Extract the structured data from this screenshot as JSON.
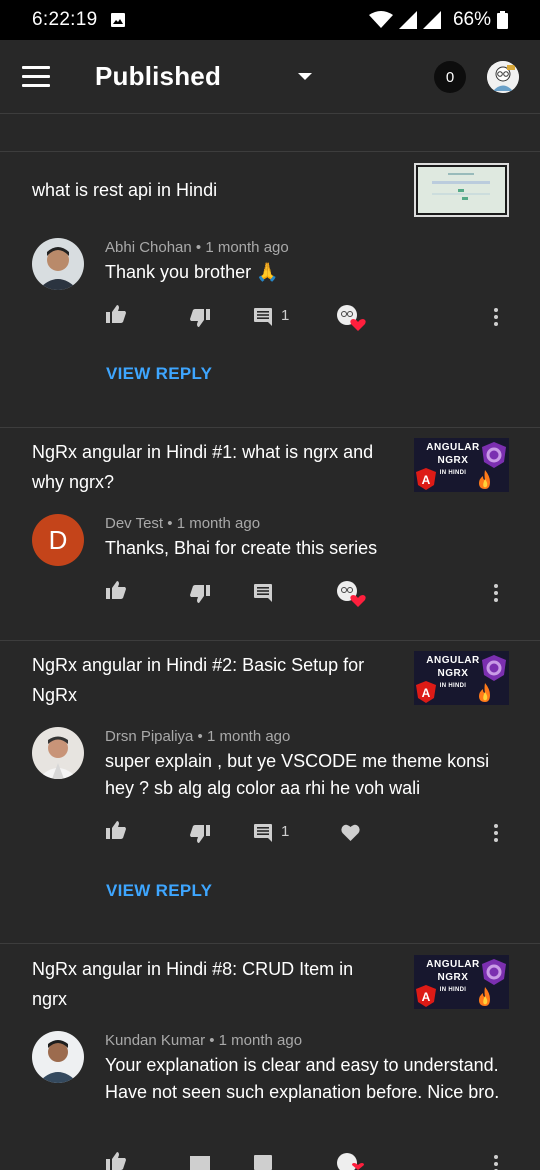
{
  "status_bar": {
    "time": "6:22:19",
    "battery": "66%"
  },
  "app_bar": {
    "title": "Published",
    "notification_count": "0"
  },
  "comments": [
    {
      "video_title": "what is rest api in Hindi",
      "author": "Abhi Chohan",
      "time": "1 month ago",
      "text": "Thank you brother 🙏",
      "reply_count": "1",
      "hearted": true,
      "view_reply_label": "VIEW REPLY"
    },
    {
      "video_title": "NgRx angular in Hindi #1: what is ngrx and why ngrx?",
      "author": "Dev Test",
      "time": "1 month ago",
      "text": "Thanks, Bhai for create this series",
      "avatar_letter": "D",
      "hearted": true
    },
    {
      "video_title": "NgRx angular in Hindi #2: Basic Setup for NgRx",
      "author": "Drsn Pipaliya",
      "time": "1 month ago",
      "text": "super explain , but ye VSCODE me theme konsi hey ? sb alg alg color aa rhi he voh wali",
      "reply_count": "1",
      "hearted": false,
      "view_reply_label": "VIEW REPLY"
    },
    {
      "video_title": "NgRx angular in Hindi #8: CRUD Item in ngrx",
      "author": "Kundan Kumar",
      "time": "1 month ago",
      "text": "Your explanation is clear and easy to understand. Have not seen such explanation before. Nice bro.",
      "hearted": true
    }
  ],
  "thumbnail_ng": {
    "line1": "ANGULAR",
    "line2": "NGRX",
    "line3": "IN HINDI"
  },
  "colors": {
    "accent": "#3ea6ff",
    "background": "#282828",
    "divider": "#3d3d3d",
    "meta": "#a9a9a9"
  }
}
